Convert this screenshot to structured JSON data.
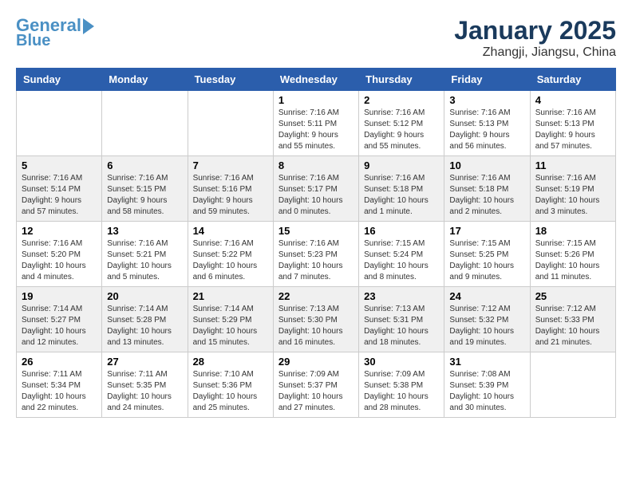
{
  "header": {
    "logo_line1": "General",
    "logo_line2": "Blue",
    "month": "January 2025",
    "location": "Zhangji, Jiangsu, China"
  },
  "weekdays": [
    "Sunday",
    "Monday",
    "Tuesday",
    "Wednesday",
    "Thursday",
    "Friday",
    "Saturday"
  ],
  "weeks": [
    [
      {
        "date": "",
        "sunrise": "",
        "sunset": "",
        "daylight": ""
      },
      {
        "date": "",
        "sunrise": "",
        "sunset": "",
        "daylight": ""
      },
      {
        "date": "",
        "sunrise": "",
        "sunset": "",
        "daylight": ""
      },
      {
        "date": "1",
        "sunrise": "Sunrise: 7:16 AM",
        "sunset": "Sunset: 5:11 PM",
        "daylight": "Daylight: 9 hours and 55 minutes."
      },
      {
        "date": "2",
        "sunrise": "Sunrise: 7:16 AM",
        "sunset": "Sunset: 5:12 PM",
        "daylight": "Daylight: 9 hours and 55 minutes."
      },
      {
        "date": "3",
        "sunrise": "Sunrise: 7:16 AM",
        "sunset": "Sunset: 5:13 PM",
        "daylight": "Daylight: 9 hours and 56 minutes."
      },
      {
        "date": "4",
        "sunrise": "Sunrise: 7:16 AM",
        "sunset": "Sunset: 5:13 PM",
        "daylight": "Daylight: 9 hours and 57 minutes."
      }
    ],
    [
      {
        "date": "5",
        "sunrise": "Sunrise: 7:16 AM",
        "sunset": "Sunset: 5:14 PM",
        "daylight": "Daylight: 9 hours and 57 minutes."
      },
      {
        "date": "6",
        "sunrise": "Sunrise: 7:16 AM",
        "sunset": "Sunset: 5:15 PM",
        "daylight": "Daylight: 9 hours and 58 minutes."
      },
      {
        "date": "7",
        "sunrise": "Sunrise: 7:16 AM",
        "sunset": "Sunset: 5:16 PM",
        "daylight": "Daylight: 9 hours and 59 minutes."
      },
      {
        "date": "8",
        "sunrise": "Sunrise: 7:16 AM",
        "sunset": "Sunset: 5:17 PM",
        "daylight": "Daylight: 10 hours and 0 minutes."
      },
      {
        "date": "9",
        "sunrise": "Sunrise: 7:16 AM",
        "sunset": "Sunset: 5:18 PM",
        "daylight": "Daylight: 10 hours and 1 minute."
      },
      {
        "date": "10",
        "sunrise": "Sunrise: 7:16 AM",
        "sunset": "Sunset: 5:18 PM",
        "daylight": "Daylight: 10 hours and 2 minutes."
      },
      {
        "date": "11",
        "sunrise": "Sunrise: 7:16 AM",
        "sunset": "Sunset: 5:19 PM",
        "daylight": "Daylight: 10 hours and 3 minutes."
      }
    ],
    [
      {
        "date": "12",
        "sunrise": "Sunrise: 7:16 AM",
        "sunset": "Sunset: 5:20 PM",
        "daylight": "Daylight: 10 hours and 4 minutes."
      },
      {
        "date": "13",
        "sunrise": "Sunrise: 7:16 AM",
        "sunset": "Sunset: 5:21 PM",
        "daylight": "Daylight: 10 hours and 5 minutes."
      },
      {
        "date": "14",
        "sunrise": "Sunrise: 7:16 AM",
        "sunset": "Sunset: 5:22 PM",
        "daylight": "Daylight: 10 hours and 6 minutes."
      },
      {
        "date": "15",
        "sunrise": "Sunrise: 7:16 AM",
        "sunset": "Sunset: 5:23 PM",
        "daylight": "Daylight: 10 hours and 7 minutes."
      },
      {
        "date": "16",
        "sunrise": "Sunrise: 7:15 AM",
        "sunset": "Sunset: 5:24 PM",
        "daylight": "Daylight: 10 hours and 8 minutes."
      },
      {
        "date": "17",
        "sunrise": "Sunrise: 7:15 AM",
        "sunset": "Sunset: 5:25 PM",
        "daylight": "Daylight: 10 hours and 9 minutes."
      },
      {
        "date": "18",
        "sunrise": "Sunrise: 7:15 AM",
        "sunset": "Sunset: 5:26 PM",
        "daylight": "Daylight: 10 hours and 11 minutes."
      }
    ],
    [
      {
        "date": "19",
        "sunrise": "Sunrise: 7:14 AM",
        "sunset": "Sunset: 5:27 PM",
        "daylight": "Daylight: 10 hours and 12 minutes."
      },
      {
        "date": "20",
        "sunrise": "Sunrise: 7:14 AM",
        "sunset": "Sunset: 5:28 PM",
        "daylight": "Daylight: 10 hours and 13 minutes."
      },
      {
        "date": "21",
        "sunrise": "Sunrise: 7:14 AM",
        "sunset": "Sunset: 5:29 PM",
        "daylight": "Daylight: 10 hours and 15 minutes."
      },
      {
        "date": "22",
        "sunrise": "Sunrise: 7:13 AM",
        "sunset": "Sunset: 5:30 PM",
        "daylight": "Daylight: 10 hours and 16 minutes."
      },
      {
        "date": "23",
        "sunrise": "Sunrise: 7:13 AM",
        "sunset": "Sunset: 5:31 PM",
        "daylight": "Daylight: 10 hours and 18 minutes."
      },
      {
        "date": "24",
        "sunrise": "Sunrise: 7:12 AM",
        "sunset": "Sunset: 5:32 PM",
        "daylight": "Daylight: 10 hours and 19 minutes."
      },
      {
        "date": "25",
        "sunrise": "Sunrise: 7:12 AM",
        "sunset": "Sunset: 5:33 PM",
        "daylight": "Daylight: 10 hours and 21 minutes."
      }
    ],
    [
      {
        "date": "26",
        "sunrise": "Sunrise: 7:11 AM",
        "sunset": "Sunset: 5:34 PM",
        "daylight": "Daylight: 10 hours and 22 minutes."
      },
      {
        "date": "27",
        "sunrise": "Sunrise: 7:11 AM",
        "sunset": "Sunset: 5:35 PM",
        "daylight": "Daylight: 10 hours and 24 minutes."
      },
      {
        "date": "28",
        "sunrise": "Sunrise: 7:10 AM",
        "sunset": "Sunset: 5:36 PM",
        "daylight": "Daylight: 10 hours and 25 minutes."
      },
      {
        "date": "29",
        "sunrise": "Sunrise: 7:09 AM",
        "sunset": "Sunset: 5:37 PM",
        "daylight": "Daylight: 10 hours and 27 minutes."
      },
      {
        "date": "30",
        "sunrise": "Sunrise: 7:09 AM",
        "sunset": "Sunset: 5:38 PM",
        "daylight": "Daylight: 10 hours and 28 minutes."
      },
      {
        "date": "31",
        "sunrise": "Sunrise: 7:08 AM",
        "sunset": "Sunset: 5:39 PM",
        "daylight": "Daylight: 10 hours and 30 minutes."
      },
      {
        "date": "",
        "sunrise": "",
        "sunset": "",
        "daylight": ""
      }
    ]
  ]
}
